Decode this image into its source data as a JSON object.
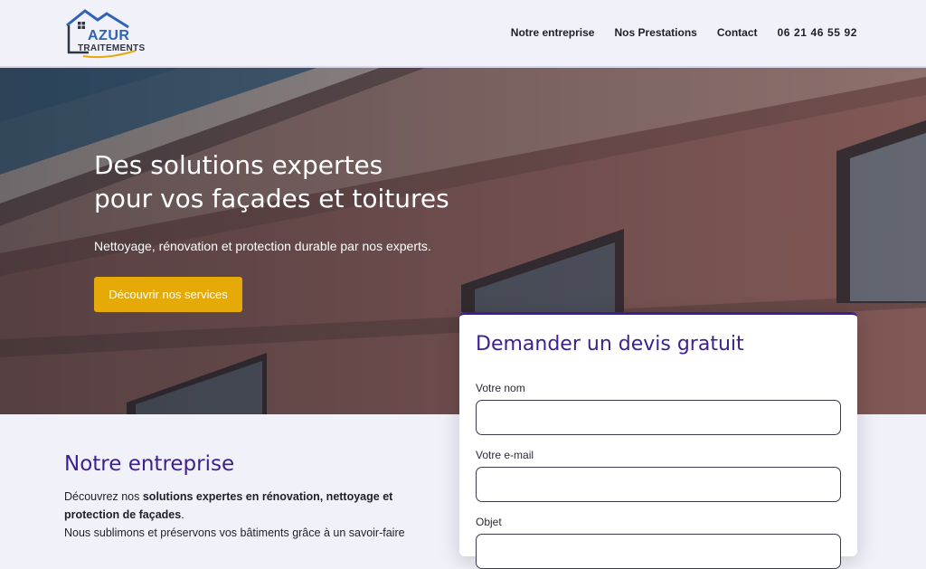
{
  "header": {
    "logo": {
      "line1": "AZUR",
      "line2": "TRAITEMENTS"
    },
    "nav": [
      "Notre entreprise",
      "Nos Prestations",
      "Contact",
      "06 21 46 55 92"
    ]
  },
  "hero": {
    "title_line1": "Des solutions expertes",
    "title_line2": "pour vos façades et toitures",
    "subtitle": "Nettoyage, rénovation et protection durable par nos experts.",
    "cta_label": "Découvrir nos services"
  },
  "quote_form": {
    "title": "Demander un devis gratuit",
    "fields": [
      {
        "label": "Votre nom",
        "value": ""
      },
      {
        "label": "Votre e-mail",
        "value": ""
      },
      {
        "label": "Objet",
        "value": ""
      }
    ]
  },
  "about": {
    "title": "Notre entreprise",
    "line1_prefix": "Découvrez nos ",
    "line1_bold": "solutions expertes en rénovation, nettoyage et",
    "line2_bold": "protection de façades",
    "line2_suffix": ".",
    "line3": "Nous sublimons et préservons vos bâtiments grâce à un savoir-faire"
  },
  "colors": {
    "accent": "#3e1f8e",
    "cta": "#e5a908",
    "logo_blue": "#2f63b7",
    "background": "#f1f1fa"
  }
}
